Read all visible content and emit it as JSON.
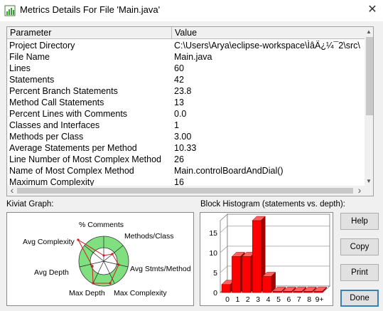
{
  "window": {
    "title": "Metrics Details For File 'Main.java'",
    "close_glyph": "✕"
  },
  "table": {
    "headers": {
      "parameter": "Parameter",
      "value": "Value"
    },
    "rows": [
      {
        "parameter": "Project Directory",
        "value": "C:\\Users\\Arya\\eclipse-workspace\\ÌâÄ¿¼¯2\\src\\"
      },
      {
        "parameter": "File Name",
        "value": "Main.java"
      },
      {
        "parameter": "Lines",
        "value": "60"
      },
      {
        "parameter": "Statements",
        "value": "42"
      },
      {
        "parameter": "Percent Branch Statements",
        "value": "23.8"
      },
      {
        "parameter": "Method Call Statements",
        "value": "13"
      },
      {
        "parameter": "Percent Lines with Comments",
        "value": "0.0"
      },
      {
        "parameter": "Classes and Interfaces",
        "value": "1"
      },
      {
        "parameter": "Methods per Class",
        "value": "3.00"
      },
      {
        "parameter": "Average Statements per Method",
        "value": "10.33"
      },
      {
        "parameter": "Line Number of Most Complex Method",
        "value": "26"
      },
      {
        "parameter": "Name of Most Complex Method",
        "value": "Main.controlBoardAndDial()"
      },
      {
        "parameter": "Maximum Complexity",
        "value": "16"
      }
    ]
  },
  "kiviat": {
    "label": "Kiviat Graph:",
    "axes": {
      "comments": "% Comments",
      "methods_class": "Methods/Class",
      "avg_stmts": "Avg Stmts/Method",
      "max_complexity": "Max Complexity",
      "max_depth": "Max Depth",
      "avg_depth": "Avg Depth",
      "avg_complexity": "Avg Complexity"
    }
  },
  "histogram": {
    "label": "Block Histogram (statements vs. depth):",
    "y_ticks": [
      "15",
      "10",
      "5",
      "0"
    ],
    "x_ticks": [
      "0",
      "1",
      "2",
      "3",
      "4",
      "5",
      "6",
      "7",
      "8",
      "9+"
    ]
  },
  "chart_data": {
    "type": "bar",
    "title": "Block Histogram (statements vs. depth):",
    "categories": [
      "0",
      "1",
      "2",
      "3",
      "4",
      "5",
      "6",
      "7",
      "8",
      "9+"
    ],
    "values": [
      2,
      9,
      9,
      18,
      4,
      0,
      0,
      0,
      0,
      0
    ],
    "ylim": [
      0,
      18
    ],
    "bar_color": "#ff0000"
  },
  "buttons": {
    "help": "Help",
    "copy": "Copy",
    "print": "Print",
    "done": "Done"
  },
  "colors": {
    "kiviat_ring": "#80e080",
    "bar": "#ff0000",
    "accent": "#3c7fb1"
  }
}
